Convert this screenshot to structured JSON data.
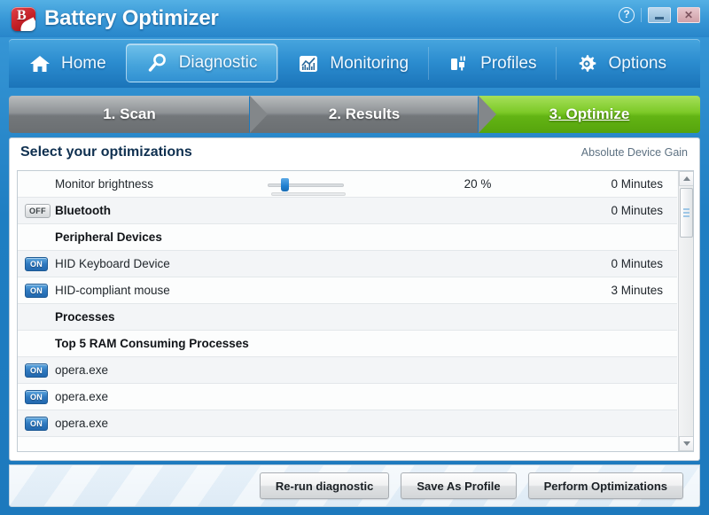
{
  "window": {
    "title": "Battery Optimizer",
    "logo_letter": "B",
    "help_label": "?",
    "minimize_label": "",
    "close_label": "✕"
  },
  "nav": {
    "items": [
      {
        "label": "Home",
        "icon": "home-icon",
        "active": false
      },
      {
        "label": "Diagnostic",
        "icon": "magnifier-icon",
        "active": true
      },
      {
        "label": "Monitoring",
        "icon": "chart-icon",
        "active": false
      },
      {
        "label": "Profiles",
        "icon": "plug-icon",
        "active": false
      },
      {
        "label": "Options",
        "icon": "gear-icon",
        "active": false
      }
    ]
  },
  "steps": [
    {
      "label": "1. Scan",
      "state": "inactive"
    },
    {
      "label": "2. Results",
      "state": "inactive"
    },
    {
      "label": "3. Optimize",
      "state": "active"
    }
  ],
  "panel": {
    "title": "Select your optimizations",
    "column_header": "Absolute Device Gain"
  },
  "rows": [
    {
      "toggle": "",
      "label": "Monitor brightness",
      "bold": false,
      "control": "slider",
      "percent": "20 %",
      "minutes": "0 Minutes"
    },
    {
      "toggle": "OFF",
      "label": "Bluetooth",
      "bold": true,
      "control": "",
      "percent": "",
      "minutes": "0 Minutes"
    },
    {
      "toggle": "",
      "label": "Peripheral Devices",
      "bold": true,
      "control": "",
      "percent": "",
      "minutes": ""
    },
    {
      "toggle": "ON",
      "label": "HID Keyboard Device",
      "bold": false,
      "control": "",
      "percent": "",
      "minutes": "0 Minutes"
    },
    {
      "toggle": "ON",
      "label": "HID-compliant mouse",
      "bold": false,
      "control": "",
      "percent": "",
      "minutes": "3 Minutes"
    },
    {
      "toggle": "",
      "label": "Processes",
      "bold": true,
      "control": "",
      "percent": "",
      "minutes": ""
    },
    {
      "toggle": "",
      "label": "Top 5 RAM Consuming Processes",
      "bold": true,
      "control": "",
      "percent": "",
      "minutes": ""
    },
    {
      "toggle": "ON",
      "label": "opera.exe",
      "bold": false,
      "control": "",
      "percent": "",
      "minutes": ""
    },
    {
      "toggle": "ON",
      "label": "opera.exe",
      "bold": false,
      "control": "",
      "percent": "",
      "minutes": ""
    },
    {
      "toggle": "ON",
      "label": "opera.exe",
      "bold": false,
      "control": "",
      "percent": "",
      "minutes": ""
    }
  ],
  "slider": {
    "value": 20,
    "max": 100
  },
  "footer": {
    "buttons": [
      {
        "label": "Re-run diagnostic"
      },
      {
        "label": "Save As Profile"
      },
      {
        "label": "Perform Optimizations"
      }
    ]
  },
  "colors": {
    "title_blue": "#2886ca",
    "nav_blue": "#2b8ccf",
    "step_active_green": "#7cc927",
    "step_inactive_gray": "#8e9295",
    "badge_on_blue": "#2f79c0",
    "accent_red": "#c32026"
  }
}
